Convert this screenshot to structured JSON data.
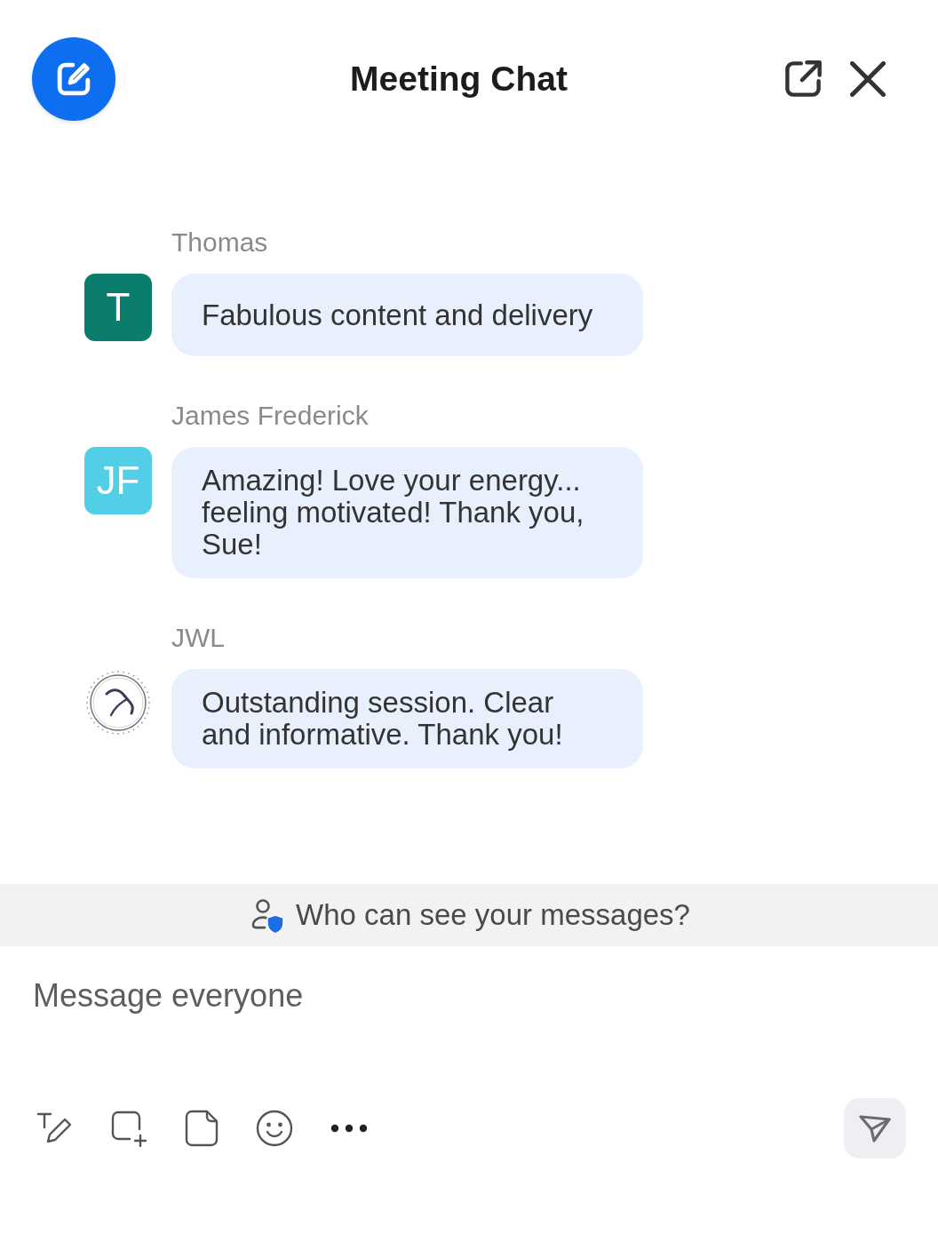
{
  "header": {
    "title": "Meeting Chat"
  },
  "messages": [
    {
      "sender": "Thomas",
      "avatar": {
        "kind": "initial",
        "text": "T",
        "color": "#0b7d6c"
      },
      "text": "Fabulous content and delivery"
    },
    {
      "sender": "James Frederick",
      "avatar": {
        "kind": "initial",
        "text": "JF",
        "color": "#52cfe6"
      },
      "text": "Amazing! Love your energy... feeling motivated! Thank you, Sue!"
    },
    {
      "sender": "JWL",
      "avatar": {
        "kind": "logo"
      },
      "text": "Outstanding session. Clear and informative. Thank you!"
    }
  ],
  "privacy_notice": {
    "text": "Who can see your messages?"
  },
  "composer": {
    "placeholder": "Message everyone",
    "send_button": {
      "disabled": true
    }
  }
}
